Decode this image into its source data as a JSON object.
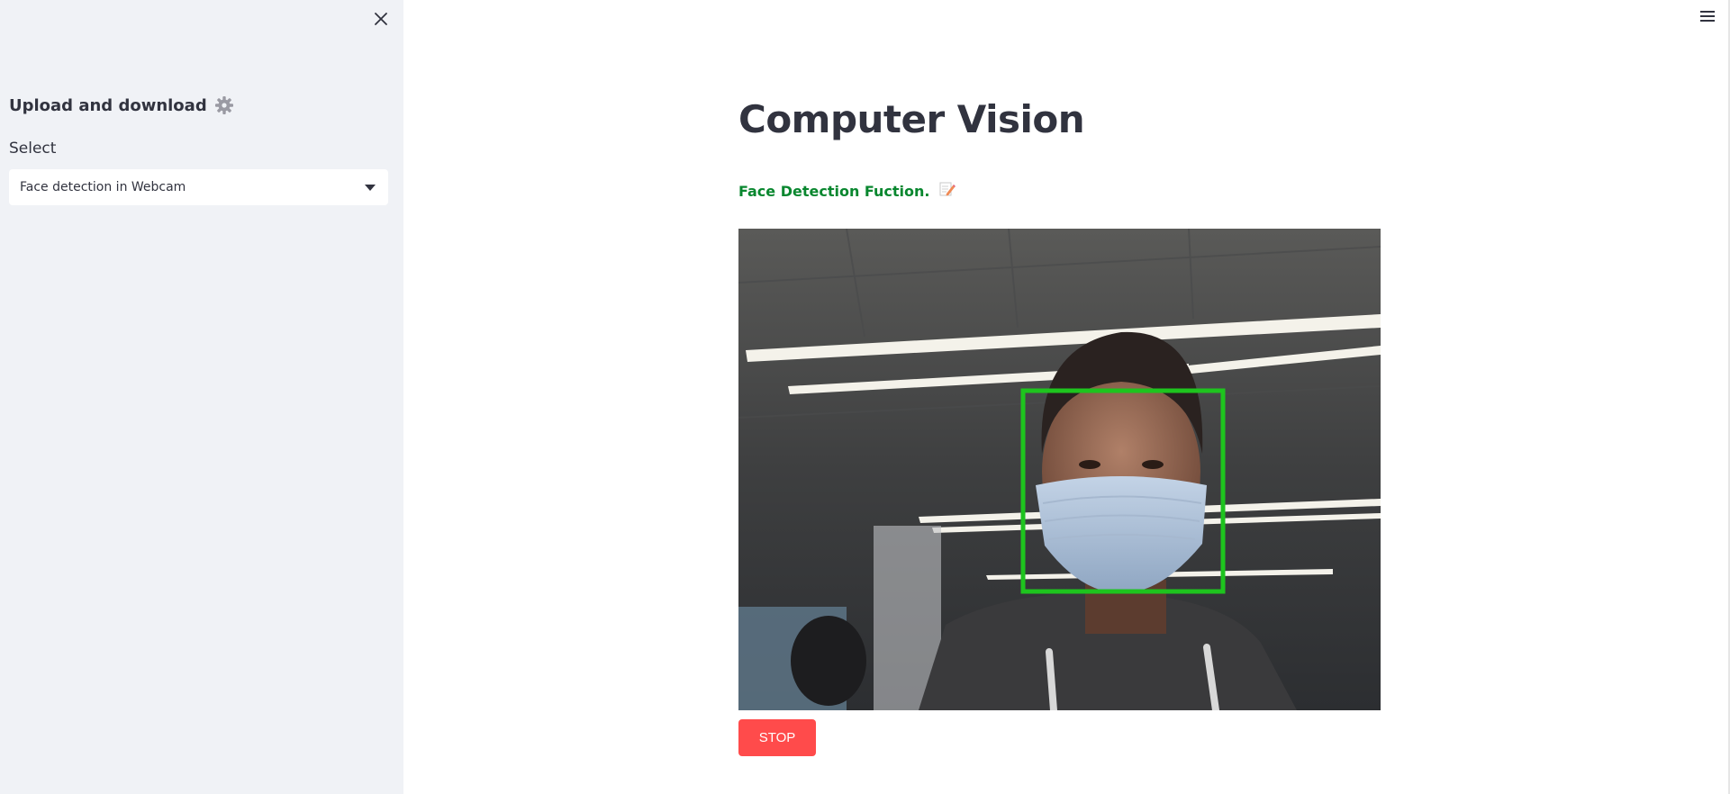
{
  "sidebar": {
    "close_icon": "close-icon",
    "title": "Upload and download",
    "title_icon": "gear-icon",
    "select_label": "Select",
    "select_value": "Face detection in Webcam",
    "select_icon": "caret-down-icon"
  },
  "main": {
    "menu_icon": "hamburger-menu-icon",
    "title": "Computer Vision",
    "subtitle": "Face Detection Fuction.",
    "subtitle_icon": "memo-icon",
    "webcam_frame": {
      "detections": [
        {
          "label": "face",
          "color": "#1ec41e"
        }
      ]
    },
    "stop_label": "STOP"
  },
  "colors": {
    "sidebar_bg": "#f0f2f6",
    "text": "#31333f",
    "subtitle_green": "#09872f",
    "stop_red": "#ff4b4b",
    "detection_box": "#1ec41e"
  }
}
